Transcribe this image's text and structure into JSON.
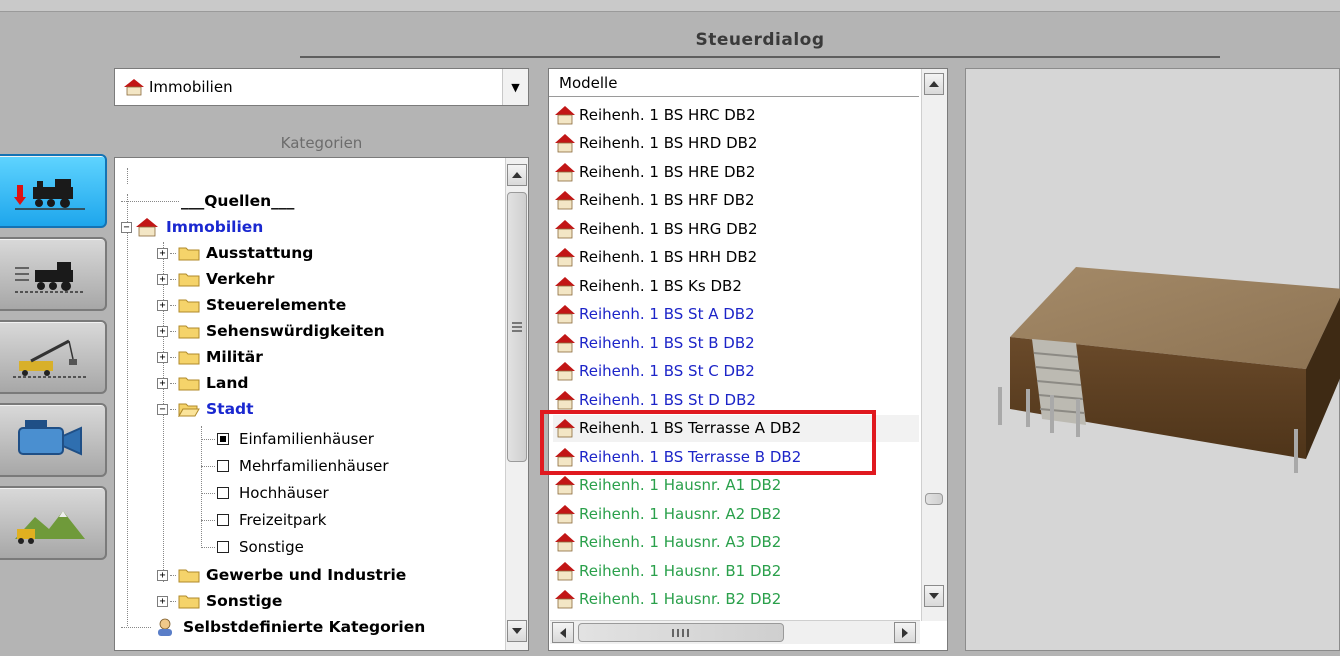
{
  "window": {
    "title": "Steuerdialog"
  },
  "tools": [
    {
      "name": "rollmaterial-insert",
      "icon": "train-down-icon"
    },
    {
      "name": "rollmaterial-list",
      "icon": "train-list-icon"
    },
    {
      "name": "immobilien",
      "icon": "crane-icon"
    },
    {
      "name": "kamera",
      "icon": "camera-icon"
    },
    {
      "name": "landschaft",
      "icon": "landscape-icon"
    }
  ],
  "combo": {
    "value": "Immobilien"
  },
  "categories_label": "Kategorien",
  "tree": {
    "quellen": "___Quellen___",
    "immobilien": "Immobilien",
    "folders": [
      "Ausstattung",
      "Verkehr",
      "Steuerelemente",
      "Sehenswürdigkeiten",
      "Militär",
      "Land"
    ],
    "stadt": "Stadt",
    "stadt_children": [
      "Einfamilienhäuser",
      "Mehrfamilienhäuser",
      "Hochhäuser",
      "Freizeitpark",
      "Sonstige"
    ],
    "gewerbe": "Gewerbe und Industrie",
    "sonstige": "Sonstige",
    "selbst": "Selbstdefinierte Kategorien"
  },
  "models": {
    "header": "Modelle",
    "items": [
      {
        "label": "Reihenh. 1 BS HRC DB2",
        "color": "#000000"
      },
      {
        "label": "Reihenh. 1 BS HRD DB2",
        "color": "#000000"
      },
      {
        "label": "Reihenh. 1 BS HRE DB2",
        "color": "#000000"
      },
      {
        "label": "Reihenh. 1 BS HRF DB2",
        "color": "#000000"
      },
      {
        "label": "Reihenh. 1 BS HRG DB2",
        "color": "#000000"
      },
      {
        "label": "Reihenh. 1 BS HRH DB2",
        "color": "#000000"
      },
      {
        "label": "Reihenh. 1 BS Ks DB2",
        "color": "#000000"
      },
      {
        "label": "Reihenh. 1 BS St A DB2",
        "color": "#1c24c8"
      },
      {
        "label": "Reihenh. 1 BS St B DB2",
        "color": "#1c24c8"
      },
      {
        "label": "Reihenh. 1 BS St C DB2",
        "color": "#1c24c8"
      },
      {
        "label": "Reihenh. 1 BS St D DB2",
        "color": "#1c24c8"
      },
      {
        "label": "Reihenh. 1 BS Terrasse A DB2",
        "color": "#000000",
        "selected": true
      },
      {
        "label": "Reihenh. 1 BS Terrasse B DB2",
        "color": "#1c24c8"
      },
      {
        "label": "Reihenh. 1 Hausnr. A1 DB2",
        "color": "#2aa04b"
      },
      {
        "label": "Reihenh. 1 Hausnr. A2 DB2",
        "color": "#2aa04b"
      },
      {
        "label": "Reihenh. 1 Hausnr. A3 DB2",
        "color": "#2aa04b"
      },
      {
        "label": "Reihenh. 1 Hausnr. B1 DB2",
        "color": "#2aa04b"
      },
      {
        "label": "Reihenh. 1 Hausnr. B2 DB2",
        "color": "#2aa04b"
      }
    ]
  },
  "highlight_color": "#e0191f"
}
